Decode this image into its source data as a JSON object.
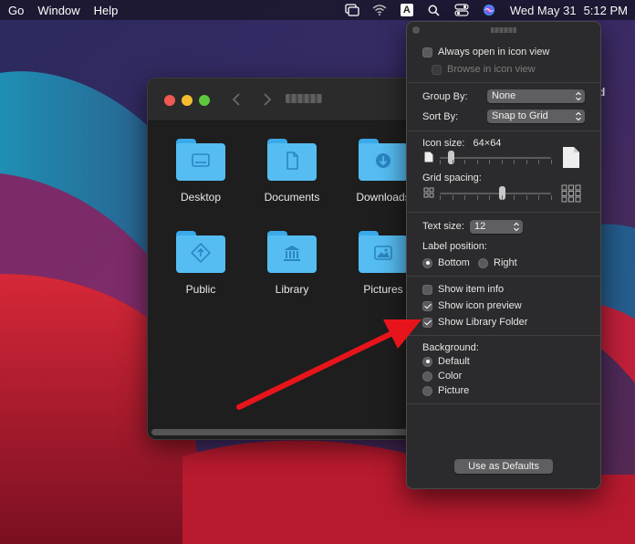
{
  "menubar": {
    "items": [
      "Go",
      "Window",
      "Help"
    ],
    "datetime": "Wed May 31",
    "time": "5:12 PM",
    "icons": [
      "screen-mirroring-icon",
      "wifi-icon",
      "input-source-icon",
      "spotlight-search-icon",
      "control-center-icon",
      "siri-icon"
    ],
    "input_source_letter": "A"
  },
  "desktop": {
    "drive_label_fragment": "d"
  },
  "finder": {
    "items": [
      {
        "label": "Desktop",
        "icon": "desktop-folder-icon"
      },
      {
        "label": "Documents",
        "icon": "documents-folder-icon"
      },
      {
        "label": "Downloads",
        "icon": "downloads-folder-icon"
      },
      {
        "label": "Public",
        "icon": "public-folder-icon"
      },
      {
        "label": "Library",
        "icon": "library-folder-icon"
      },
      {
        "label": "Pictures",
        "icon": "pictures-folder-icon"
      }
    ]
  },
  "view_options": {
    "always_open_icon_view": {
      "label": "Always open in icon view",
      "checked": false
    },
    "browse_icon_view": {
      "label": "Browse in icon view",
      "checked": false,
      "enabled": false
    },
    "group_by": {
      "label": "Group By:",
      "value": "None"
    },
    "sort_by": {
      "label": "Sort By:",
      "value": "Snap to Grid"
    },
    "icon_size": {
      "label": "Icon size:",
      "value": "64×64",
      "level": 0.1
    },
    "grid_spacing": {
      "label": "Grid spacing:",
      "level": 0.56
    },
    "text_size": {
      "label": "Text size:",
      "value": "12"
    },
    "label_position": {
      "label": "Label position:",
      "options": [
        "Bottom",
        "Right"
      ],
      "selected": "Bottom"
    },
    "show_item_info": {
      "label": "Show item info",
      "checked": false
    },
    "show_icon_preview": {
      "label": "Show icon preview",
      "checked": true
    },
    "show_library_folder": {
      "label": "Show Library Folder",
      "checked": true
    },
    "background": {
      "label": "Background:",
      "options": [
        "Default",
        "Color",
        "Picture"
      ],
      "selected": "Default"
    },
    "defaults_button": "Use as Defaults"
  },
  "annotation": {
    "color": "#e8141b"
  },
  "colors": {
    "folder": "#56bdf3",
    "panel": "#2b2b2d"
  }
}
